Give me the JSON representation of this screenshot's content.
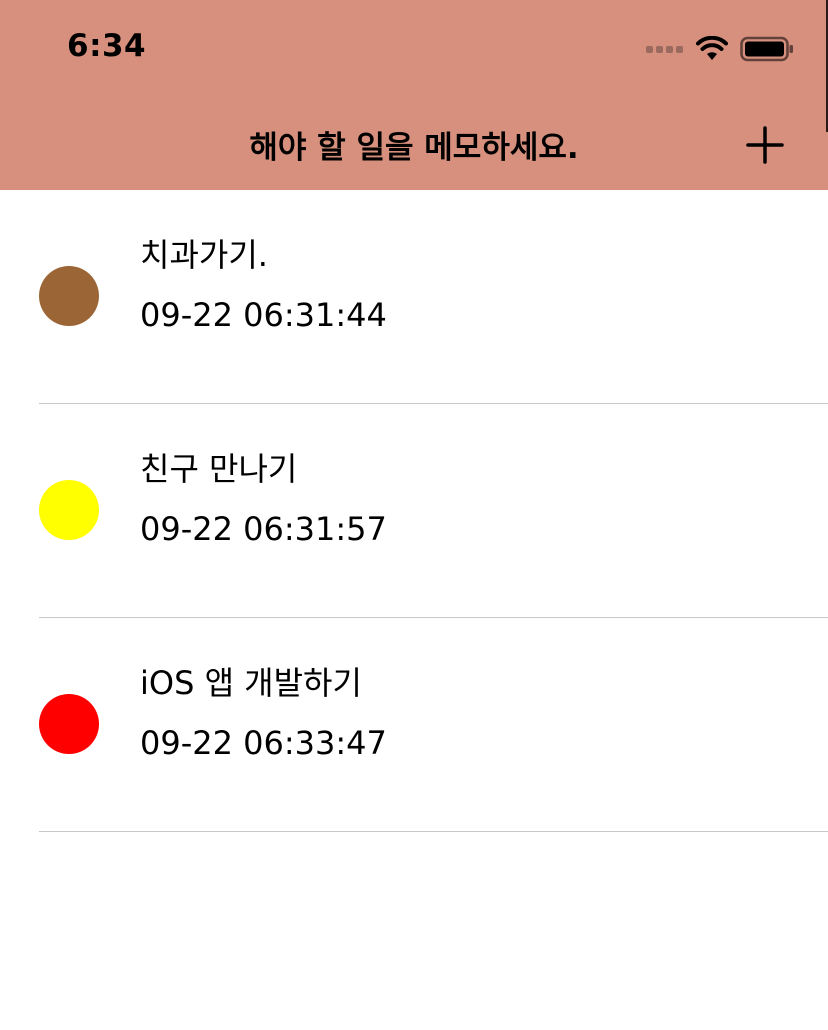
{
  "status_bar": {
    "time": "6:34",
    "icons": [
      "signal-dots-icon",
      "wifi-icon",
      "battery-icon"
    ]
  },
  "nav": {
    "title": "해야 할 일을 메모하세요.",
    "add_icon": "plus-icon",
    "background": "#d8907e"
  },
  "memos": [
    {
      "title": "치과가기.",
      "date": "09-22 06:31:44",
      "color": "#9b6535"
    },
    {
      "title": "친구 만나기",
      "date": "09-22 06:31:57",
      "color": "#ffff00"
    },
    {
      "title": "iOS 앱 개발하기",
      "date": "09-22 06:33:47",
      "color": "#ff0000"
    }
  ]
}
